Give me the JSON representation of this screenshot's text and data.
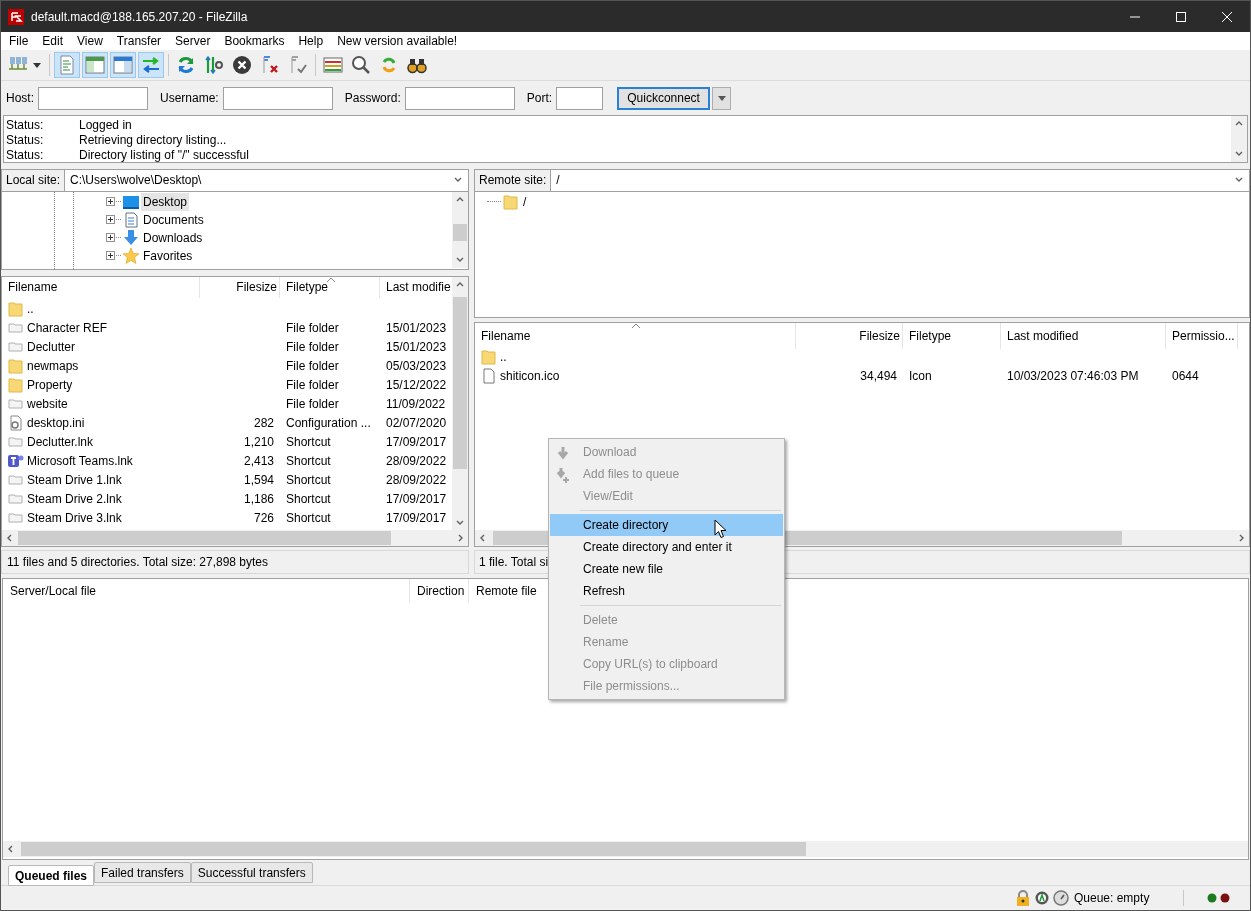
{
  "window": {
    "title": "default.macd@188.165.207.20 - FileZilla"
  },
  "menu": [
    "File",
    "Edit",
    "View",
    "Transfer",
    "Server",
    "Bookmarks",
    "Help",
    "New version available!"
  ],
  "toolbar": {
    "toggles": [
      {
        "on": true
      },
      {
        "on": true
      },
      {
        "on": true
      },
      {
        "on": true
      }
    ]
  },
  "quickconnect": {
    "fields": [
      {
        "label": "Host:"
      },
      {
        "label": "Username:"
      },
      {
        "label": "Password:"
      },
      {
        "label": "Port:"
      }
    ],
    "button": "Quickconnect"
  },
  "log": [
    {
      "label": "Status:",
      "message": "Logged in"
    },
    {
      "label": "Status:",
      "message": "Retrieving directory listing..."
    },
    {
      "label": "Status:",
      "message": "Directory listing of \"/\" successful"
    }
  ],
  "local": {
    "label": "Local site:",
    "path": "C:\\Users\\wolve\\Desktop\\",
    "tree": [
      {
        "label": "Desktop",
        "kind": "desktop",
        "expanded": false,
        "selected": true
      },
      {
        "label": "Documents",
        "kind": "documents",
        "expanded": false,
        "selected": false
      },
      {
        "label": "Downloads",
        "kind": "downloads",
        "expanded": false,
        "selected": false
      },
      {
        "label": "Favorites",
        "kind": "favorites",
        "expanded": false,
        "selected": false
      }
    ],
    "columns": [
      "Filename",
      "Filesize",
      "Filetype",
      "Last modifie"
    ],
    "rows": [
      {
        "kind": "folder",
        "cells": [
          "..",
          "",
          "",
          ""
        ]
      },
      {
        "kind": "link",
        "cells": [
          "Character REF",
          "",
          "File folder",
          "15/01/2023"
        ]
      },
      {
        "kind": "link",
        "cells": [
          "Declutter",
          "",
          "File folder",
          "15/01/2023"
        ]
      },
      {
        "kind": "folder",
        "cells": [
          "newmaps",
          "",
          "File folder",
          "05/03/2023"
        ]
      },
      {
        "kind": "folder",
        "cells": [
          "Property",
          "",
          "File folder",
          "15/12/2022"
        ]
      },
      {
        "kind": "link",
        "cells": [
          "website",
          "",
          "File folder",
          "11/09/2022"
        ]
      },
      {
        "kind": "settings",
        "cells": [
          "desktop.ini",
          "282",
          "Configuration ...",
          "02/07/2020"
        ]
      },
      {
        "kind": "link",
        "cells": [
          "Declutter.lnk",
          "1,210",
          "Shortcut",
          "17/09/2017"
        ]
      },
      {
        "kind": "app",
        "cells": [
          "Microsoft Teams.lnk",
          "2,413",
          "Shortcut",
          "28/09/2022"
        ]
      },
      {
        "kind": "link",
        "cells": [
          "Steam Drive 1.lnk",
          "1,594",
          "Shortcut",
          "28/09/2022"
        ]
      },
      {
        "kind": "link",
        "cells": [
          "Steam Drive 2.lnk",
          "1,186",
          "Shortcut",
          "17/09/2017"
        ]
      },
      {
        "kind": "link",
        "cells": [
          "Steam Drive 3.lnk",
          "726",
          "Shortcut",
          "17/09/2017"
        ]
      }
    ],
    "status": "11 files and 5 directories. Total size: 27,898 bytes"
  },
  "remote": {
    "label": "Remote site:",
    "path": "/",
    "tree": [
      {
        "label": "/",
        "kind": "folder"
      }
    ],
    "columns": [
      "Filename",
      "Filesize",
      "Filetype",
      "Last modified",
      "Permissio..."
    ],
    "rows": [
      {
        "kind": "folder",
        "cells": [
          "..",
          "",
          "",
          "",
          ""
        ]
      },
      {
        "kind": "file",
        "cells": [
          "shiticon.ico",
          "34,494",
          "Icon",
          "10/03/2023 07:46:03 PM",
          "0644"
        ]
      }
    ],
    "status": "1 file. Total si"
  },
  "context_menu": [
    {
      "kind": "item",
      "label": "Download",
      "disabled": true,
      "selected": false
    },
    {
      "kind": "item",
      "label": "Add files to queue",
      "disabled": true,
      "selected": false
    },
    {
      "kind": "item",
      "label": "View/Edit",
      "disabled": true,
      "selected": false
    },
    {
      "kind": "separator"
    },
    {
      "kind": "item",
      "label": "Create directory",
      "disabled": false,
      "selected": true
    },
    {
      "kind": "item",
      "label": "Create directory and enter it",
      "disabled": false,
      "selected": false
    },
    {
      "kind": "item",
      "label": "Create new file",
      "disabled": false,
      "selected": false
    },
    {
      "kind": "item",
      "label": "Refresh",
      "disabled": false,
      "selected": false
    },
    {
      "kind": "separator"
    },
    {
      "kind": "item",
      "label": "Delete",
      "disabled": true,
      "selected": false
    },
    {
      "kind": "item",
      "label": "Rename",
      "disabled": true,
      "selected": false
    },
    {
      "kind": "item",
      "label": "Copy URL(s) to clipboard",
      "disabled": true,
      "selected": false
    },
    {
      "kind": "item",
      "label": "File permissions...",
      "disabled": true,
      "selected": false
    }
  ],
  "queue": {
    "columns": [
      "Server/Local file",
      "Direction",
      "Remote file"
    ]
  },
  "queue_tabs": [
    {
      "label": "Queued files",
      "selected": true
    },
    {
      "label": "Failed transfers",
      "selected": false
    },
    {
      "label": "Successful transfers",
      "selected": false
    }
  ],
  "status_bar": {
    "queue": "Queue: empty"
  }
}
